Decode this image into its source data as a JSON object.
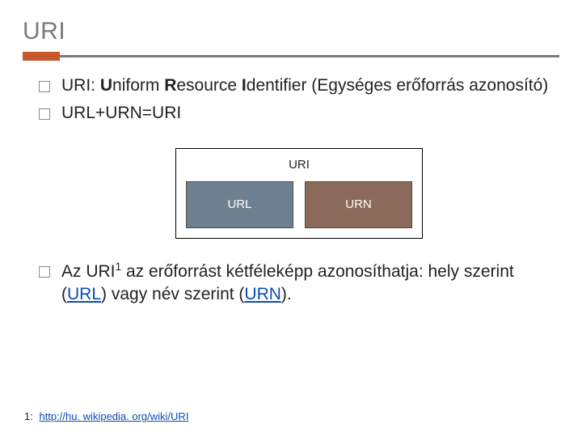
{
  "title": "URI",
  "bullets": {
    "b1_pre": "URI: ",
    "b1_u": "U",
    "b1_mid1": "niform ",
    "b1_r": "R",
    "b1_mid2": "esource ",
    "b1_i": "I",
    "b1_post": "dentifier (Egységes erőforrás azonosító)",
    "b2": "URL+URN=URI",
    "b3_pre": "Az URI",
    "b3_sup": "1",
    "b3_mid1": " az erőforrást kétféleképp azonosíthatja: hely szerint (",
    "b3_link1": "URL",
    "b3_mid2": ") vagy név szerint (",
    "b3_link2": "URN",
    "b3_post": ")."
  },
  "diagram": {
    "outer_label": "URI",
    "url_label": "URL",
    "urn_label": "URN"
  },
  "footnote": {
    "num": "1:",
    "link_text": "http://hu. wikipedia. org/wiki/URI"
  }
}
